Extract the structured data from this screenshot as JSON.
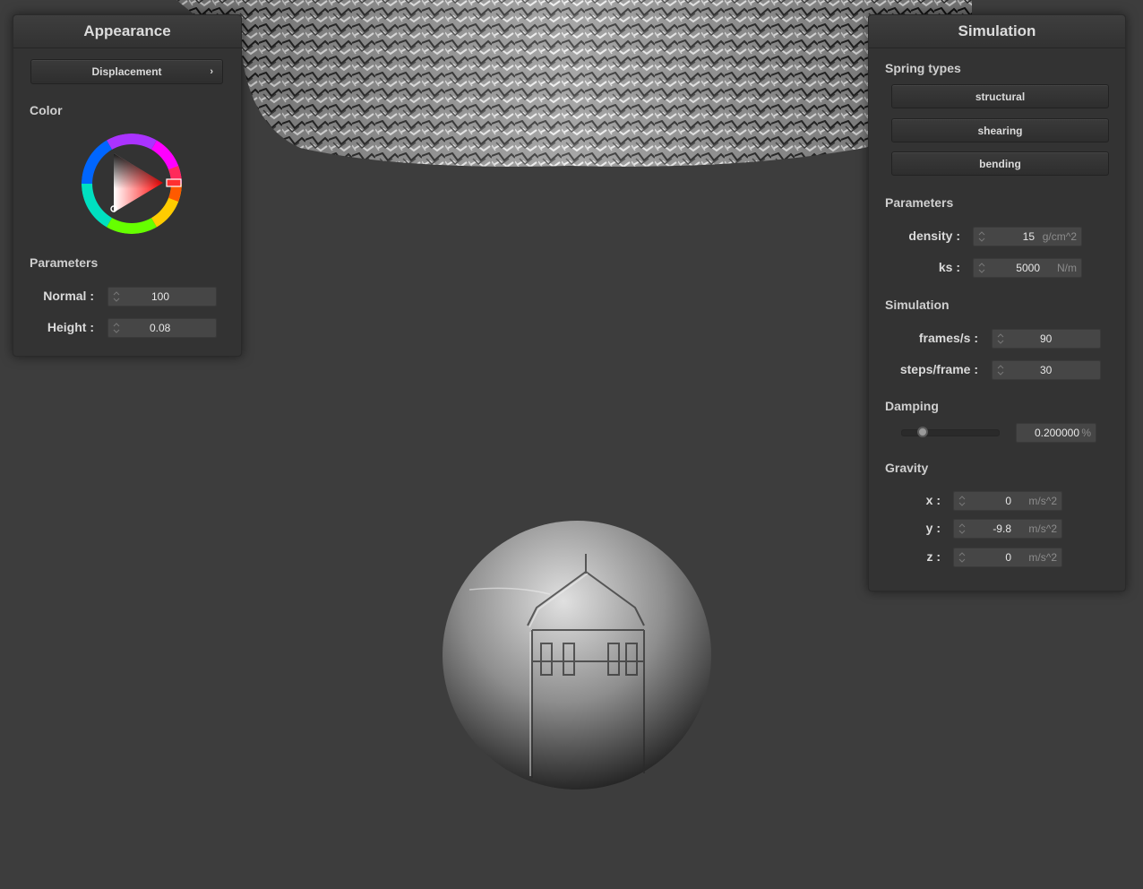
{
  "appearance": {
    "title": "Appearance",
    "shader_dropdown": "Displacement",
    "color_label": "Color",
    "parameters_label": "Parameters",
    "normal_label": "Normal :",
    "normal_value": "100",
    "height_label": "Height :",
    "height_value": "0.08",
    "selected_color": "#ff0000"
  },
  "simulation": {
    "title": "Simulation",
    "spring_types_label": "Spring types",
    "spring_buttons": [
      "structural",
      "shearing",
      "bending"
    ],
    "parameters_label": "Parameters",
    "density_label": "density :",
    "density_value": "15",
    "density_unit": "g/cm^2",
    "ks_label": "ks :",
    "ks_value": "5000",
    "ks_unit": "N/m",
    "simulation_label": "Simulation",
    "fps_label": "frames/s :",
    "fps_value": "90",
    "steps_label": "steps/frame :",
    "steps_value": "30",
    "damping_label": "Damping",
    "damping_value": "0.200000",
    "damping_unit": "%",
    "damping_fraction": 0.2,
    "gravity_label": "Gravity",
    "gx_label": "x :",
    "gx_value": "0",
    "gy_label": "y :",
    "gy_value": "-9.8",
    "gz_label": "z :",
    "gz_value": "0",
    "gravity_unit": "m/s^2"
  }
}
